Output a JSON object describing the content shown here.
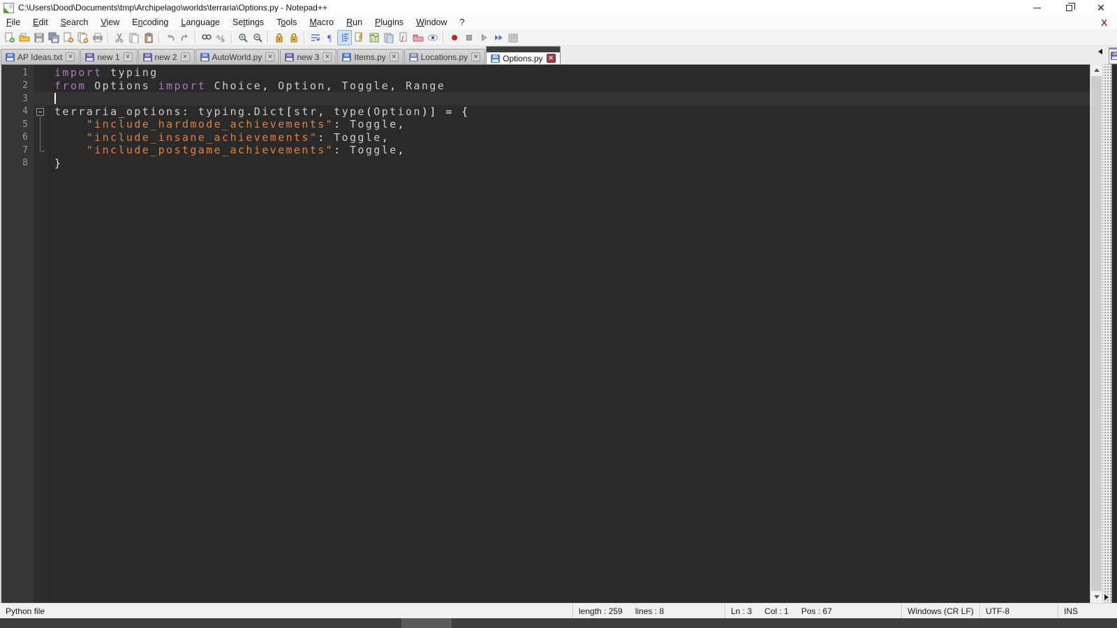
{
  "window": {
    "title": "C:\\Users\\Dood\\Documents\\tmp\\Archipelago\\worlds\\terraria\\Options.py - Notepad++",
    "controls": {
      "minimize": "minimize",
      "restore": "restore",
      "close": "✕"
    }
  },
  "menu": {
    "items": [
      {
        "label": "File",
        "accel": 0
      },
      {
        "label": "Edit",
        "accel": 0
      },
      {
        "label": "Search",
        "accel": 0
      },
      {
        "label": "View",
        "accel": 0
      },
      {
        "label": "Encoding",
        "accel": 1
      },
      {
        "label": "Language",
        "accel": 0
      },
      {
        "label": "Settings",
        "accel": 2
      },
      {
        "label": "Tools",
        "accel": 1
      },
      {
        "label": "Macro",
        "accel": 0
      },
      {
        "label": "Run",
        "accel": 0
      },
      {
        "label": "Plugins",
        "accel": 0
      },
      {
        "label": "Window",
        "accel": 0
      },
      {
        "label": "?",
        "accel": -1
      }
    ],
    "close_document_x": "X"
  },
  "toolbar": {
    "icons": [
      "new-file",
      "open",
      "save",
      "save-all",
      "close",
      "close-all",
      "print",
      "sep",
      "cut",
      "copy",
      "paste",
      "sep",
      "undo",
      "redo",
      "sep",
      "find",
      "replace",
      "sep",
      "zoom-in",
      "zoom-out",
      "sep",
      "sync-vertical",
      "sync-horizontal",
      "sep",
      "word-wrap",
      "show-all-characters",
      "indent-guide",
      "style-configurator",
      "document-map",
      "document-list",
      "function-list",
      "folder-as-workspace",
      "monitoring-eye",
      "sep",
      "macro-record",
      "macro-stop",
      "macro-play",
      "macro-run-multiple",
      "macro-save"
    ],
    "pressed": [
      "indent-guide"
    ]
  },
  "tabs": [
    {
      "label": "AP Ideas.txt",
      "state": "inactive",
      "icon": "blue"
    },
    {
      "label": "new 1",
      "state": "inactive",
      "icon": "purple"
    },
    {
      "label": "new 2",
      "state": "inactive",
      "icon": "purple"
    },
    {
      "label": "AutoWorld.py",
      "state": "inactive",
      "icon": "blue"
    },
    {
      "label": "new 3",
      "state": "inactive",
      "icon": "purple"
    },
    {
      "label": "Items.py",
      "state": "inactive",
      "icon": "blue"
    },
    {
      "label": "Locations.py",
      "state": "inactive",
      "icon": "greyblue"
    },
    {
      "label": "Options.py",
      "state": "active",
      "icon": "active-blue"
    }
  ],
  "editor": {
    "lines": [
      {
        "num": "1",
        "fold": null,
        "current": false,
        "caret": false,
        "tokens": [
          [
            "kw",
            "import"
          ],
          [
            "def",
            " typing"
          ]
        ]
      },
      {
        "num": "2",
        "fold": null,
        "current": false,
        "caret": false,
        "tokens": [
          [
            "kw",
            "from"
          ],
          [
            "def",
            " Options "
          ],
          [
            "kw",
            "import"
          ],
          [
            "def",
            " Choice"
          ],
          [
            "op",
            ","
          ],
          [
            "def",
            " Option"
          ],
          [
            "op",
            ","
          ],
          [
            "def",
            " Toggle"
          ],
          [
            "op",
            ","
          ],
          [
            "def",
            " Range"
          ]
        ]
      },
      {
        "num": "3",
        "fold": null,
        "current": true,
        "caret": true,
        "tokens": []
      },
      {
        "num": "4",
        "fold": "box",
        "current": false,
        "caret": false,
        "tokens": [
          [
            "def",
            "terraria_options"
          ],
          [
            "op",
            ":"
          ],
          [
            "def",
            " typing"
          ],
          [
            "op",
            "."
          ],
          [
            "def",
            "Dict"
          ],
          [
            "op",
            "["
          ],
          [
            "def",
            "str"
          ],
          [
            "op",
            ","
          ],
          [
            "def",
            " type"
          ],
          [
            "op",
            "("
          ],
          [
            "def",
            "Option"
          ],
          [
            "op",
            ")"
          ],
          [
            "op",
            "]"
          ],
          [
            "def",
            " "
          ],
          [
            "op",
            "="
          ],
          [
            "def",
            " "
          ],
          [
            "op",
            "{"
          ]
        ]
      },
      {
        "num": "5",
        "fold": "line",
        "current": false,
        "caret": false,
        "tokens": [
          [
            "def",
            "    "
          ],
          [
            "str",
            "\"include_hardmode_achievements\""
          ],
          [
            "op",
            ":"
          ],
          [
            "def",
            " Toggle"
          ],
          [
            "op",
            ","
          ]
        ]
      },
      {
        "num": "6",
        "fold": "line",
        "current": false,
        "caret": false,
        "tokens": [
          [
            "def",
            "    "
          ],
          [
            "str",
            "\"include_insane_achievements\""
          ],
          [
            "op",
            ":"
          ],
          [
            "def",
            " Toggle"
          ],
          [
            "op",
            ","
          ]
        ]
      },
      {
        "num": "7",
        "fold": "end",
        "current": false,
        "caret": false,
        "tokens": [
          [
            "def",
            "    "
          ],
          [
            "str",
            "\"include_postgame_achievements\""
          ],
          [
            "op",
            ":"
          ],
          [
            "def",
            " Toggle"
          ],
          [
            "op",
            ","
          ]
        ]
      },
      {
        "num": "8",
        "fold": null,
        "current": false,
        "caret": false,
        "tokens": [
          [
            "op",
            "}"
          ]
        ]
      }
    ]
  },
  "status_bar": {
    "doc_type": "Python file",
    "length_label": "length : 259",
    "lines_label": "lines : 8",
    "ln_label": "Ln : 3",
    "col_label": "Col : 1",
    "pos_label": "Pos : 67",
    "eol": "Windows (CR LF)",
    "encoding": "UTF-8",
    "insert_mode": "INS"
  },
  "colors": {
    "keyword": "#a978bd",
    "string": "#e2813c",
    "default_text": "#cdcdcd",
    "editor_bg": "#2a2a2a",
    "current_line_bg": "#343434",
    "gutter_bg": "#363636",
    "active_tab_close_bg": "#9e3d46",
    "menu_close_x": "#8e3a3a"
  }
}
